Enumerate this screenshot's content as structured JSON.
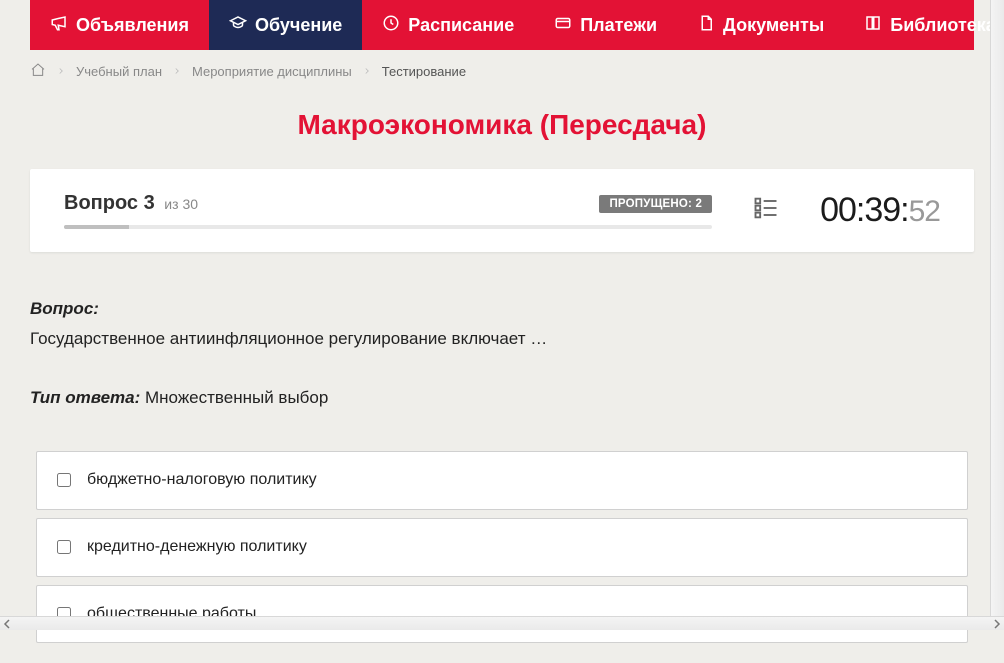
{
  "nav": {
    "items": [
      {
        "label": "Объявления",
        "icon": "megaphone-icon",
        "active": false
      },
      {
        "label": "Обучение",
        "icon": "graduation-cap-icon",
        "active": true
      },
      {
        "label": "Расписание",
        "icon": "clock-icon",
        "active": false
      },
      {
        "label": "Платежи",
        "icon": "credit-card-icon",
        "active": false
      },
      {
        "label": "Документы",
        "icon": "file-icon",
        "active": false
      },
      {
        "label": "Библиотека",
        "icon": "book-icon",
        "active": false,
        "has_dropdown": true
      }
    ]
  },
  "breadcrumb": {
    "items": [
      {
        "label": "Учебный план",
        "current": false
      },
      {
        "label": "Мероприятие дисциплины",
        "current": false
      },
      {
        "label": "Тестирование",
        "current": true
      }
    ]
  },
  "title": "Макроэкономика (Пересдача)",
  "question_header": {
    "prefix": "Вопрос",
    "number": "3",
    "of_prefix": "из",
    "total": "30",
    "skipped_label": "ПРОПУЩЕНО: 2",
    "progress_percent": 10
  },
  "timer": {
    "mm": "00",
    "ss": "39",
    "ms": "52"
  },
  "question": {
    "label": "Вопрос:",
    "text": "Государственное антиинфляционное регулирование включает …",
    "answer_type_label": "Тип ответа:",
    "answer_type": "Множественный выбор"
  },
  "answers": [
    {
      "text": "бюджетно-налоговую политику",
      "checked": false
    },
    {
      "text": "кредитно-денежную политику",
      "checked": false
    },
    {
      "text": "общественные работы",
      "checked": false
    }
  ]
}
